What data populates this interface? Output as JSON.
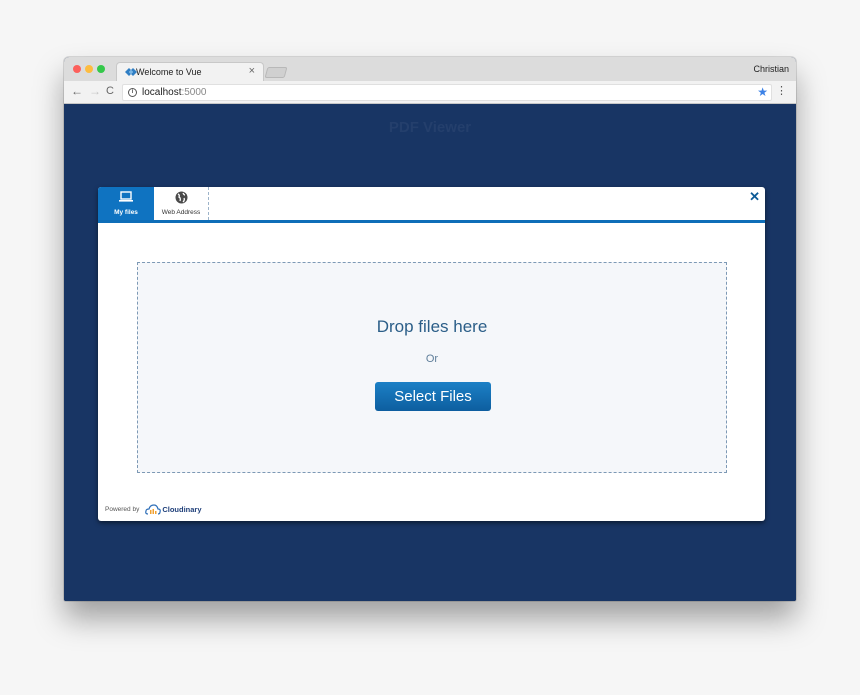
{
  "browser": {
    "tab_title": "Welcome to Vue",
    "tab_close": "×",
    "profile_name": "Christian",
    "url_host": "localhost",
    "url_port": ":5000",
    "back_icon": "←",
    "forward_icon": "→",
    "reload_icon": "C",
    "info_icon": "i",
    "star_icon": "★",
    "menu_icon": "⋮"
  },
  "page": {
    "title": "PDF Viewer"
  },
  "widget": {
    "tabs": [
      {
        "label": "My files",
        "icon": "laptop-icon",
        "active": true
      },
      {
        "label": "Web Address",
        "icon": "globe-icon",
        "active": false
      }
    ],
    "close_icon": "✕",
    "drop_title": "Drop files here",
    "or_label": "Or",
    "select_button": "Select Files",
    "powered_by": "Powered by",
    "brand": "Cloudinary",
    "colors": {
      "accent": "#0f73c1",
      "page_bg": "#183564",
      "drop_text": "#2b5e88"
    }
  }
}
